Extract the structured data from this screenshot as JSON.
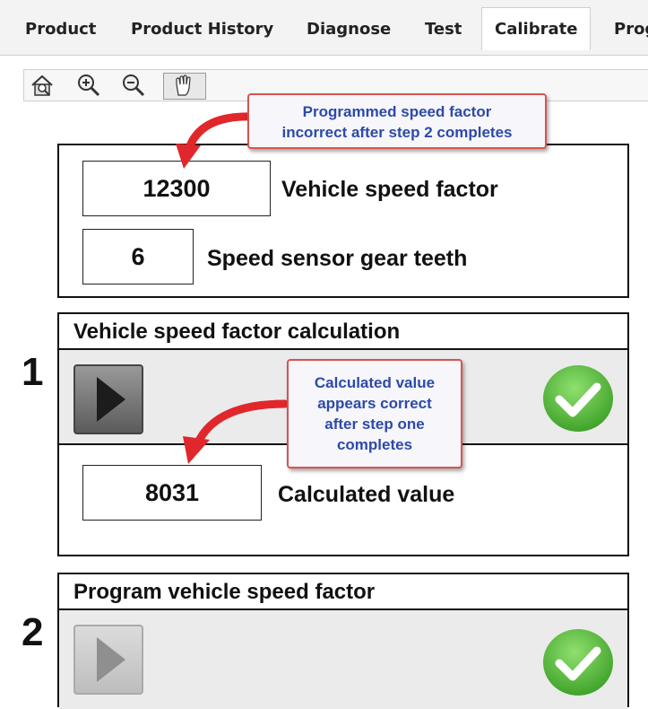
{
  "tabs": [
    {
      "label": "Product"
    },
    {
      "label": "Product History"
    },
    {
      "label": "Diagnose"
    },
    {
      "label": "Test"
    },
    {
      "label": "Calibrate",
      "active": true
    },
    {
      "label": "Prog"
    }
  ],
  "toolbar": {
    "icons": [
      "home-zoom-icon",
      "zoom-in-icon",
      "zoom-out-icon",
      "pan-hand-icon"
    ]
  },
  "top_panel": {
    "vehicle_speed_factor_value": "12300",
    "vehicle_speed_factor_label": "Vehicle speed factor",
    "gear_teeth_value": "6",
    "gear_teeth_label": "Speed sensor gear teeth"
  },
  "step1": {
    "number": "1",
    "header": "Vehicle speed factor calculation",
    "calculated_value": "8031",
    "calculated_label": "Calculated value"
  },
  "step2": {
    "number": "2",
    "header": "Program vehicle speed factor"
  },
  "callouts": {
    "top_line1": "Programmed speed factor",
    "top_line2": "incorrect after step 2 completes",
    "mid_line1": "Calculated value",
    "mid_line2": "appears correct",
    "mid_line3": "after step one",
    "mid_line4": "completes"
  },
  "colors": {
    "callout_border": "#d9534f",
    "callout_text": "#2d4aa8",
    "arrow": "#e0272b",
    "check_green": "#3fae2a"
  }
}
